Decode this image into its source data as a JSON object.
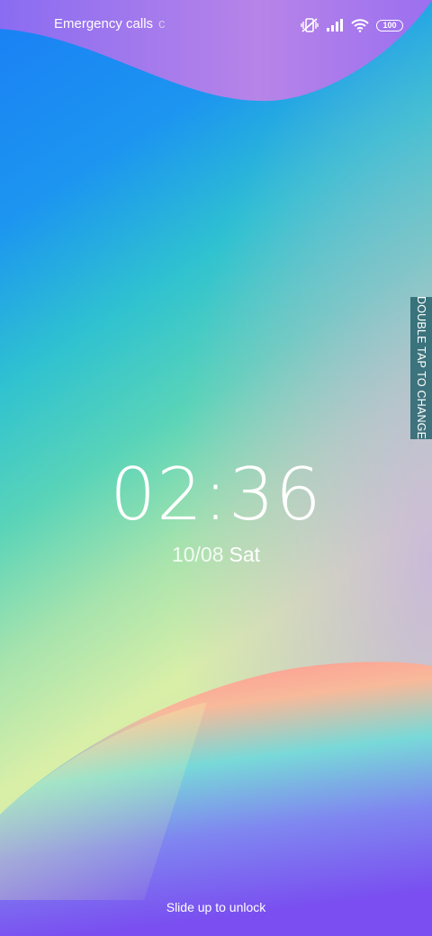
{
  "status_bar": {
    "carrier_text": "Emergency calls",
    "carrier_fade_text": "c",
    "battery_level": "100",
    "icons": [
      "vibrate-off-icon",
      "signal-icon",
      "wifi-icon",
      "battery-icon"
    ]
  },
  "side_tab": {
    "label": "DOUBLE TAP TO CHANGE"
  },
  "lockscreen": {
    "time": "02:36",
    "date": "10/08",
    "day": "Sat",
    "unlock_hint": "Slide up to unlock"
  },
  "colors": {
    "blue": "#1e8cff",
    "teal": "#35c9c1",
    "purple": "#8a5cf0",
    "pink": "#ff8a9a",
    "yellow": "#e8f5a0"
  }
}
